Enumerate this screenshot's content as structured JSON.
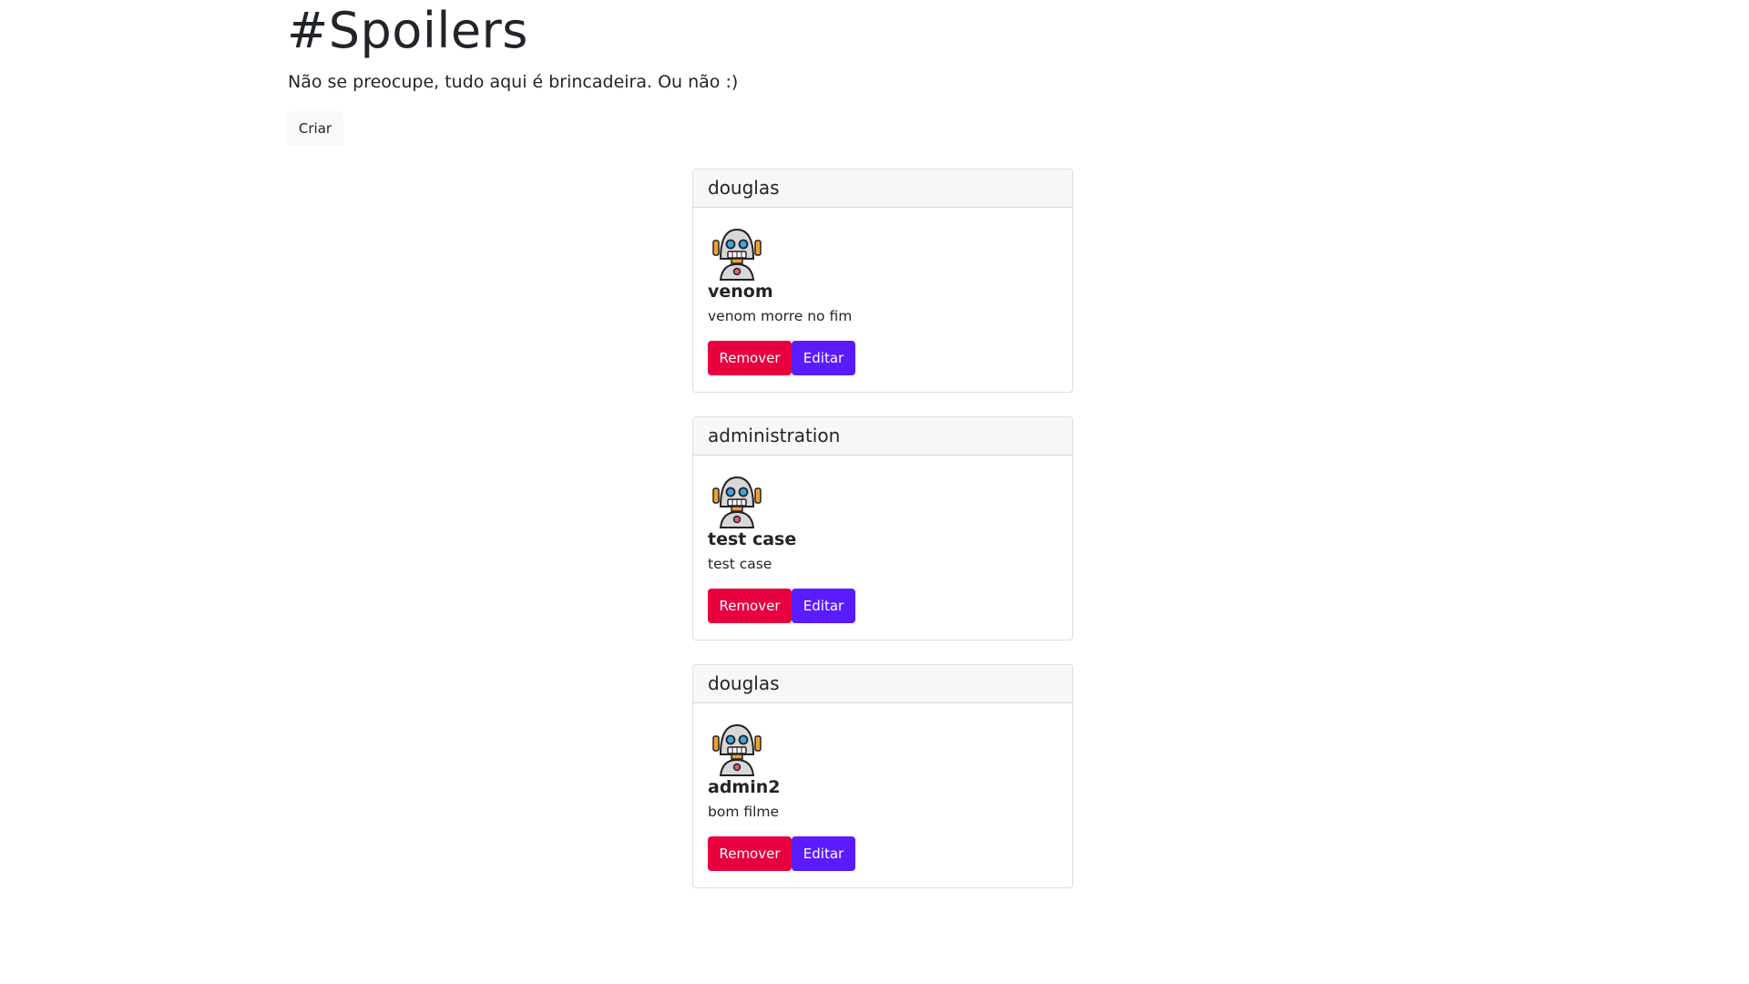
{
  "page": {
    "title": "#Spoilers",
    "subtitle": "Não se preocupe, tudo aqui é brincadeira. Ou não :)",
    "create_label": "Criar"
  },
  "colors": {
    "remove": "#e8003f",
    "edit": "#5a1bff",
    "header_bg": "#f7f7f7"
  },
  "cards": [
    {
      "author": "douglas",
      "avatar_icon": "robot-icon",
      "title": "venom",
      "text": "venom morre no fim",
      "remove_label": "Remover",
      "edit_label": "Editar"
    },
    {
      "author": "administration",
      "avatar_icon": "robot-icon",
      "title": "test case",
      "text": "test case",
      "remove_label": "Remover",
      "edit_label": "Editar"
    },
    {
      "author": "douglas",
      "avatar_icon": "robot-icon",
      "title": "admin2",
      "text": "bom filme",
      "remove_label": "Remover",
      "edit_label": "Editar"
    }
  ]
}
